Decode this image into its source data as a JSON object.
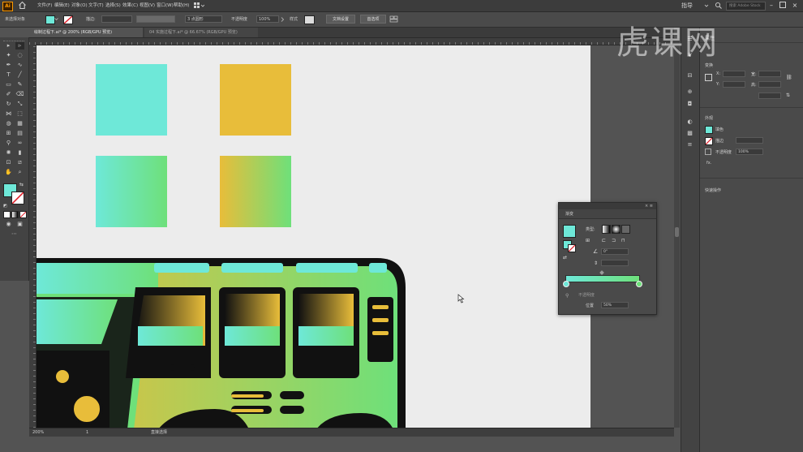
{
  "app": {
    "logo_text": "Ai"
  },
  "menu": {
    "items": [
      "文件(F)",
      "编辑(E)",
      "对象(O)",
      "文字(T)",
      "选择(S)",
      "效果(C)",
      "视图(V)",
      "窗口(W)",
      "帮助(H)"
    ],
    "right_label": "指导",
    "search_placeholder": "搜索 Adobe Stock"
  },
  "control_bar": {
    "selection_label": "未选择对象",
    "stroke_label": "描边:",
    "stroke_value": "",
    "brush_value": "3 点圆形",
    "opacity_label": "不透明度",
    "opacity_value": "100%",
    "style_label": "样式",
    "doc_setup_button": "文档设置",
    "prefs_button": "首选项"
  },
  "tabs": [
    {
      "label": "绘制过程下.ai* @ 200% (RGB/GPU 预览)",
      "active": true
    },
    {
      "label": "04 实施过程下.ai* @ 66.67% (RGB/GPU 预览)",
      "active": false
    }
  ],
  "status_bar": {
    "zoom": "200%",
    "page": "1",
    "tool_name": "直接选择"
  },
  "watermark": "虎课网",
  "swatches": {
    "solid_cyan": "#6ee8d8",
    "solid_yellow": "#e8bd3a",
    "gradient_cyan_green": [
      "#6ee8d8",
      "#6ee07a"
    ],
    "gradient_yellow_green": [
      "#e8bd3a",
      "#6ee07a"
    ]
  },
  "properties_panel": {
    "tab_label": "属性",
    "section_transform": "变换",
    "transform_fields": [
      "X:",
      "Y:",
      "宽:",
      "高:"
    ],
    "angle_value": "0°",
    "section_appearance": "外观",
    "fill_label": "填色",
    "stroke_label": "描边",
    "opacity_label": "不透明度",
    "opacity_value": "100%",
    "fx_label": "fx.",
    "section_quick": "快速操作"
  },
  "gradient_panel": {
    "title": "渐变",
    "type_label": "类型:",
    "angle_value": "0°",
    "opacity_label": "不透明度",
    "location_label": "位置",
    "location_value": "50%"
  },
  "colors": {
    "ui_dark": "#3c3c3c",
    "ui_mid": "#4a4a4a",
    "artboard": "#ececec",
    "accent_cyan": "#6ee8d8",
    "accent_green": "#6ee07a",
    "accent_yellow": "#e8bd3a",
    "outline": "#111111"
  }
}
